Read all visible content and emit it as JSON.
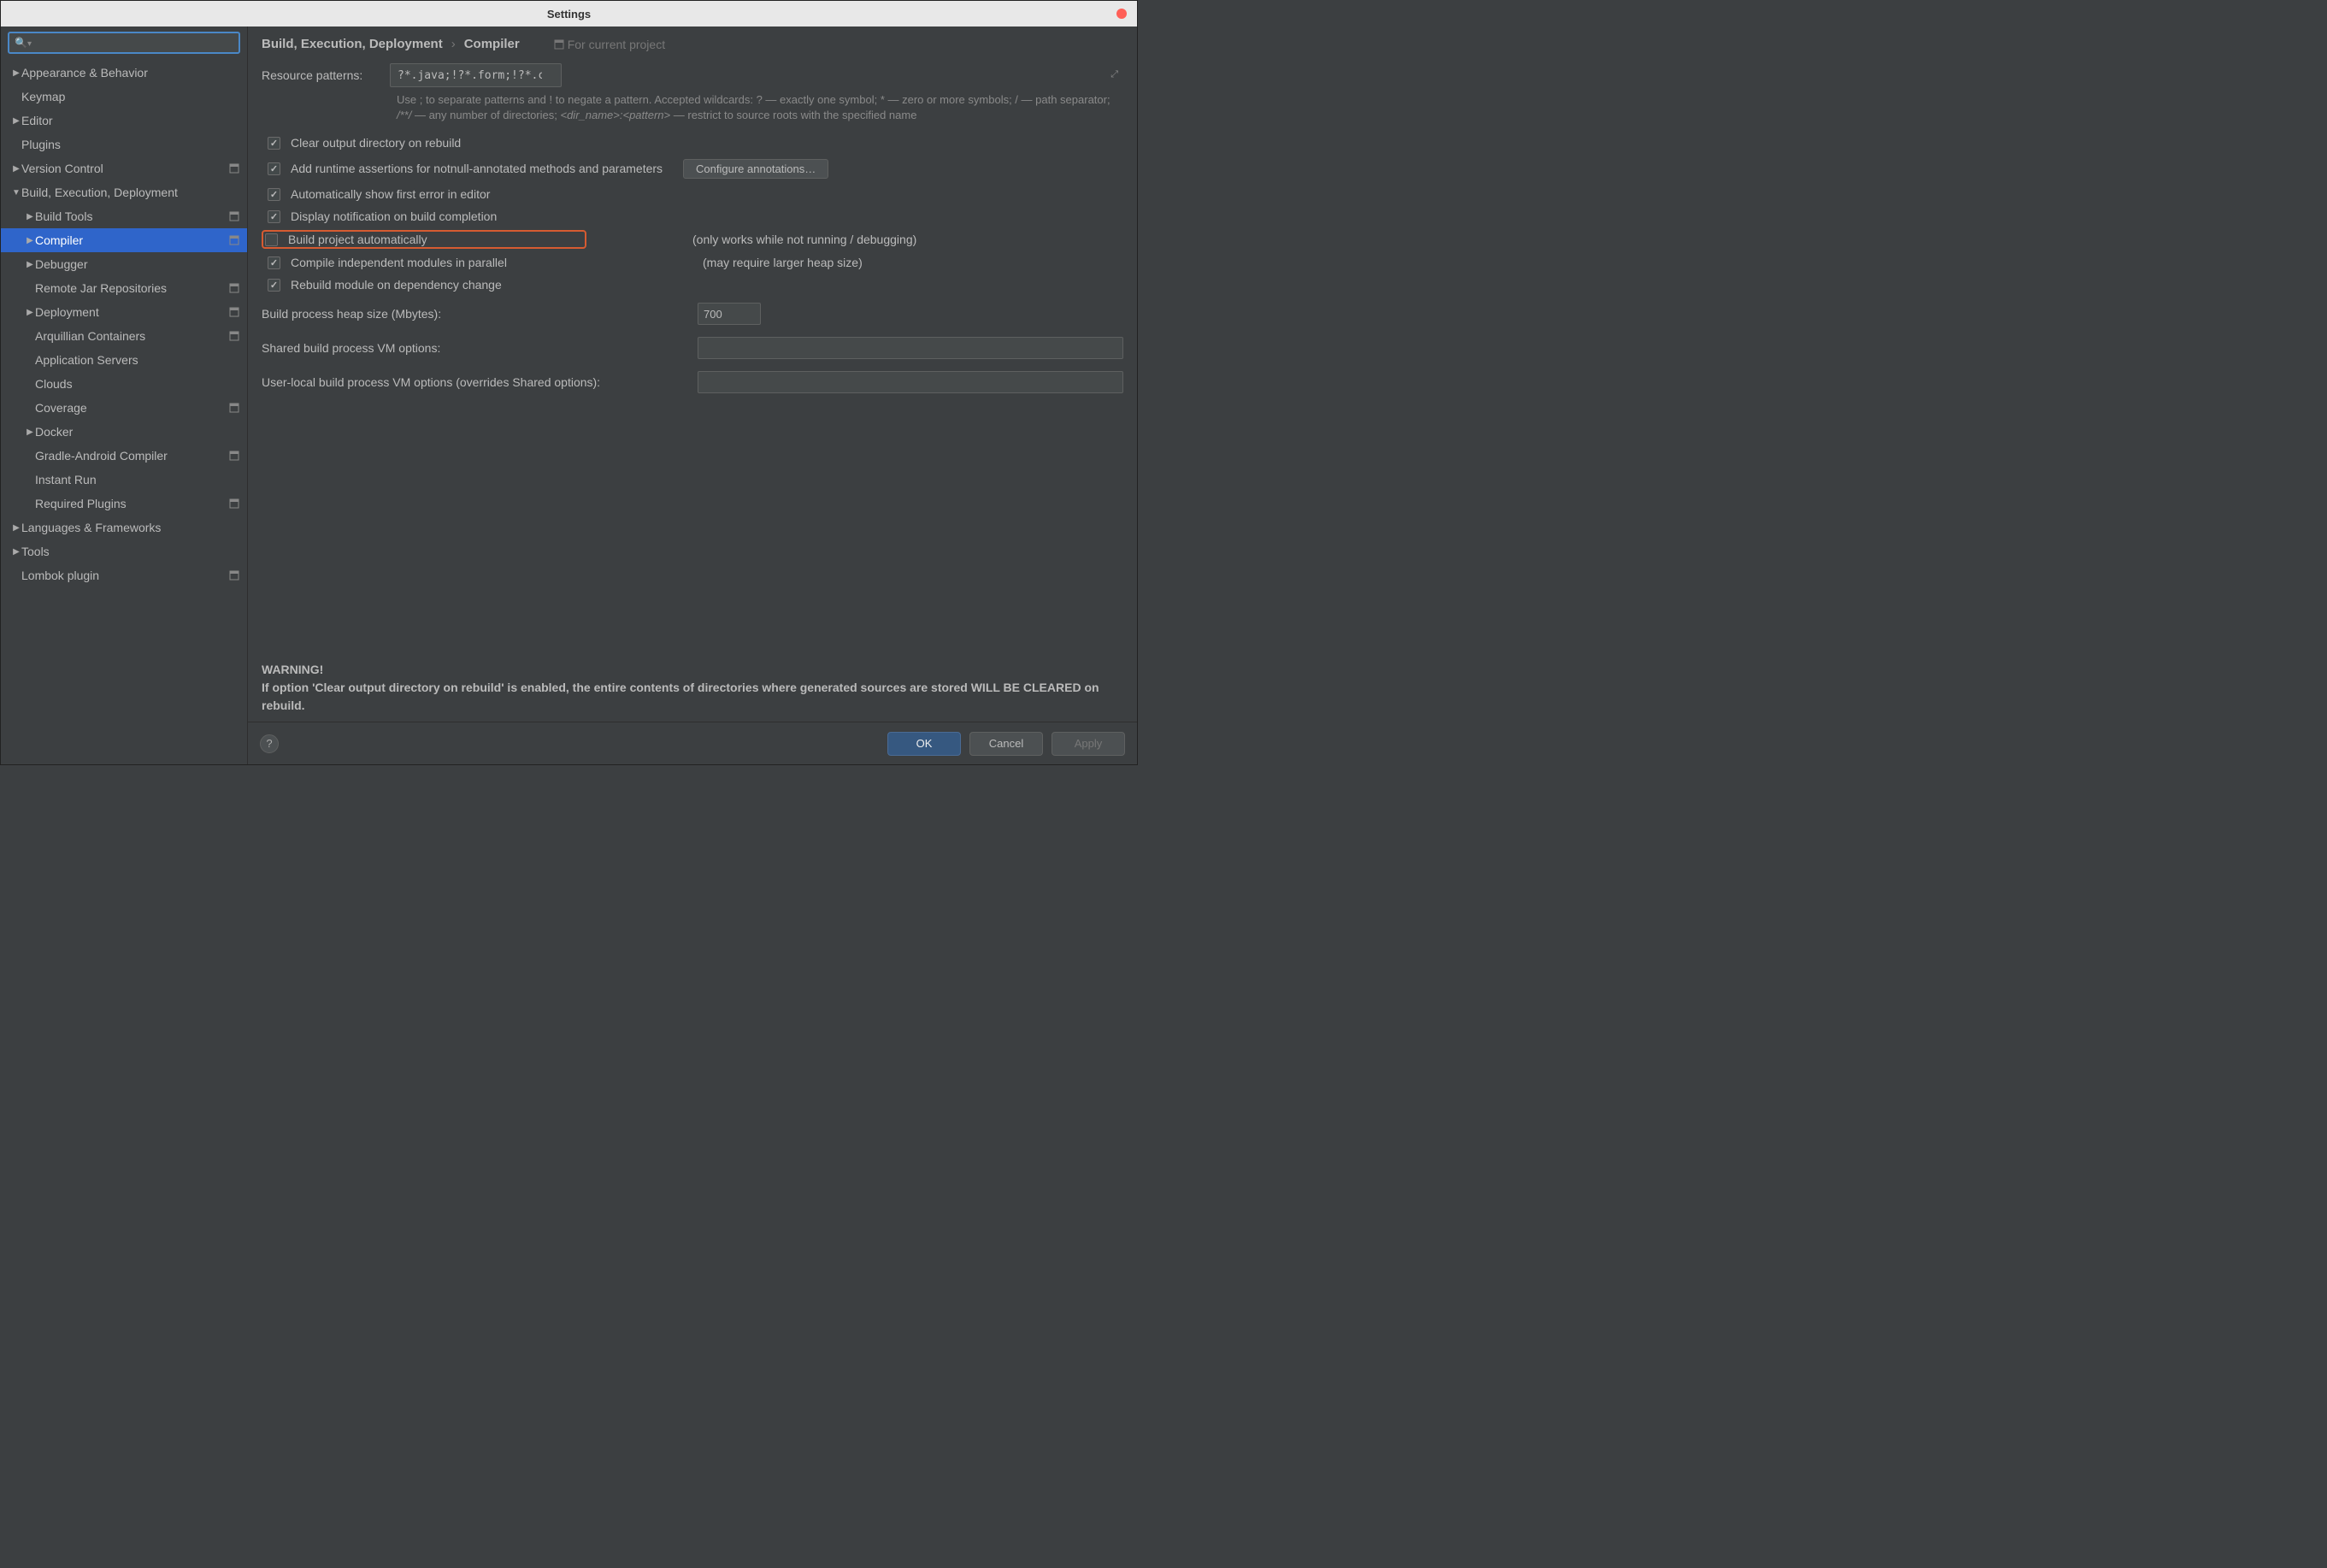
{
  "window": {
    "title": "Settings"
  },
  "search": {
    "placeholder": ""
  },
  "sidebar": {
    "items": [
      {
        "label": "Appearance & Behavior",
        "indent": 0,
        "arrow": "right",
        "badge": false
      },
      {
        "label": "Keymap",
        "indent": 0,
        "arrow": "none",
        "badge": false
      },
      {
        "label": "Editor",
        "indent": 0,
        "arrow": "right",
        "badge": false
      },
      {
        "label": "Plugins",
        "indent": 0,
        "arrow": "none",
        "badge": false
      },
      {
        "label": "Version Control",
        "indent": 0,
        "arrow": "right",
        "badge": true
      },
      {
        "label": "Build, Execution, Deployment",
        "indent": 0,
        "arrow": "down",
        "badge": false
      },
      {
        "label": "Build Tools",
        "indent": 1,
        "arrow": "right",
        "badge": true
      },
      {
        "label": "Compiler",
        "indent": 1,
        "arrow": "right",
        "badge": true,
        "selected": true
      },
      {
        "label": "Debugger",
        "indent": 1,
        "arrow": "right",
        "badge": false
      },
      {
        "label": "Remote Jar Repositories",
        "indent": 1,
        "arrow": "none",
        "badge": true
      },
      {
        "label": "Deployment",
        "indent": 1,
        "arrow": "right",
        "badge": true
      },
      {
        "label": "Arquillian Containers",
        "indent": 1,
        "arrow": "none",
        "badge": true
      },
      {
        "label": "Application Servers",
        "indent": 1,
        "arrow": "none",
        "badge": false
      },
      {
        "label": "Clouds",
        "indent": 1,
        "arrow": "none",
        "badge": false
      },
      {
        "label": "Coverage",
        "indent": 1,
        "arrow": "none",
        "badge": true
      },
      {
        "label": "Docker",
        "indent": 1,
        "arrow": "right",
        "badge": false
      },
      {
        "label": "Gradle-Android Compiler",
        "indent": 1,
        "arrow": "none",
        "badge": true
      },
      {
        "label": "Instant Run",
        "indent": 1,
        "arrow": "none",
        "badge": false
      },
      {
        "label": "Required Plugins",
        "indent": 1,
        "arrow": "none",
        "badge": true
      },
      {
        "label": "Languages & Frameworks",
        "indent": 0,
        "arrow": "right",
        "badge": false
      },
      {
        "label": "Tools",
        "indent": 0,
        "arrow": "right",
        "badge": false
      },
      {
        "label": "Lombok plugin",
        "indent": 0,
        "arrow": "none",
        "badge": true
      }
    ]
  },
  "breadcrumb": {
    "parent": "Build, Execution, Deployment",
    "sep": "›",
    "child": "Compiler",
    "hint": "For current project"
  },
  "resource": {
    "label": "Resource patterns:",
    "value": "?*.java;!?*.form;!?*.class;!?*.groovy;!?*.scala;!?*.flex;!?*.kt;!?*.clj;!?*.aj",
    "hint": "Use ; to separate patterns and ! to negate a pattern. Accepted wildcards: ? — exactly one symbol; * — zero or more symbols; / — path separator; /**/ — any number of directories; <dir_name>:<pattern> — restrict to source roots with the specified name"
  },
  "checks": {
    "clear_output": {
      "label": "Clear output directory on rebuild",
      "checked": true
    },
    "add_runtime": {
      "label": "Add runtime assertions for notnull-annotated methods and parameters",
      "checked": true,
      "button": "Configure annotations…"
    },
    "auto_show_error": {
      "label": "Automatically show first error in editor",
      "checked": true
    },
    "display_notif": {
      "label": "Display notification on build completion",
      "checked": true
    },
    "build_auto": {
      "label": "Build project automatically",
      "checked": false,
      "note": "(only works while not running / debugging)"
    },
    "compile_parallel": {
      "label": "Compile independent modules in parallel",
      "checked": true,
      "note": "(may require larger heap size)"
    },
    "rebuild_dep": {
      "label": "Rebuild module on dependency change",
      "checked": true
    }
  },
  "fields": {
    "heap": {
      "label": "Build process heap size (Mbytes):",
      "value": "700"
    },
    "shared_vm": {
      "label": "Shared build process VM options:",
      "value": ""
    },
    "user_vm": {
      "label": "User-local build process VM options (overrides Shared options):",
      "value": ""
    }
  },
  "warning": {
    "title": "WARNING!",
    "body": "If option 'Clear output directory on rebuild' is enabled, the entire contents of directories where generated sources are stored WILL BE CLEARED on rebuild."
  },
  "footer": {
    "ok": "OK",
    "cancel": "Cancel",
    "apply": "Apply"
  }
}
